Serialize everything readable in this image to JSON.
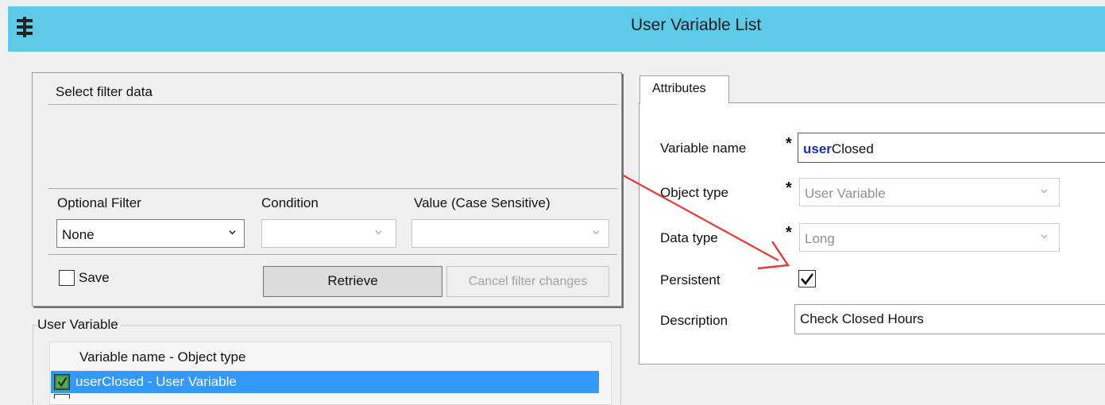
{
  "window": {
    "title": "User Variable List",
    "menu_icon": "hamburger-menu-icon"
  },
  "filter": {
    "section_title": "Select filter data",
    "optional_filter": {
      "label": "Optional Filter",
      "value": "None"
    },
    "condition": {
      "label": "Condition",
      "value": ""
    },
    "value_case_sensitive": {
      "label": "Value (Case Sensitive)",
      "value": ""
    },
    "save": {
      "label": "Save",
      "checked": false
    },
    "retrieve_label": "Retrieve",
    "cancel_label": "Cancel filter changes"
  },
  "user_variable": {
    "group_title": "User Variable",
    "column_header": "Variable name - Object type",
    "rows": [
      {
        "label": "userClosed - User Variable",
        "checked": true,
        "selected": true
      }
    ]
  },
  "attributes": {
    "tab_label": "Attributes",
    "variable_name": {
      "label": "Variable name",
      "required": "*",
      "value_bold": "user",
      "value_rest": "Closed"
    },
    "object_type": {
      "label": "Object type",
      "required": "*",
      "value": "User Variable"
    },
    "data_type": {
      "label": "Data type",
      "required": "*",
      "value": "Long"
    },
    "persistent": {
      "label": "Persistent",
      "checked": true
    },
    "description": {
      "label": "Description",
      "value": "Check Closed Hours"
    }
  },
  "colors": {
    "titlebar": "#5dcbe8",
    "selection": "#3399ff",
    "annotation_arrow": "#e53935"
  }
}
